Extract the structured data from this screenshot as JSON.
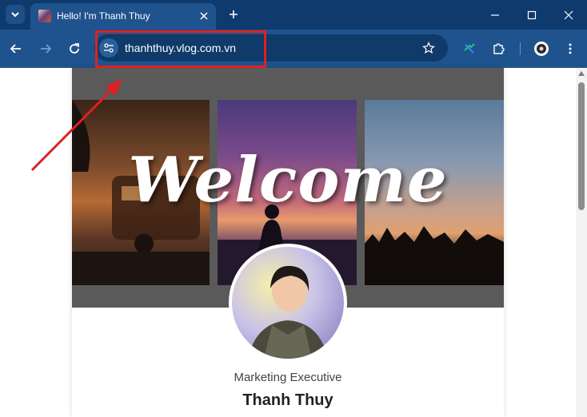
{
  "browser": {
    "tab_title": "Hello! I'm Thanh Thuy",
    "url": "thanhthuy.vlog.com.vn",
    "icons": {
      "tab_search": "chevron-down-icon",
      "tab_close": "close-icon",
      "new_tab": "plus-icon",
      "minimize": "minimize-icon",
      "maximize": "maximize-icon",
      "close_window": "close-icon",
      "back": "back-arrow-icon",
      "forward": "forward-arrow-icon",
      "reload": "reload-icon",
      "site_info": "tune-icon",
      "bookmark": "star-icon",
      "extension_1": "extension-colorful-icon",
      "extensions": "puzzle-icon",
      "profile": "profile-icon",
      "menu": "more-vert-icon"
    },
    "colors": {
      "tabstrip": "#0e3a6e",
      "toolbar": "#1f538e",
      "annotation": "#e02020"
    }
  },
  "page": {
    "banner_text": "Welcome",
    "profile_role": "Marketing Executive",
    "profile_name": "Thanh Thuy"
  }
}
